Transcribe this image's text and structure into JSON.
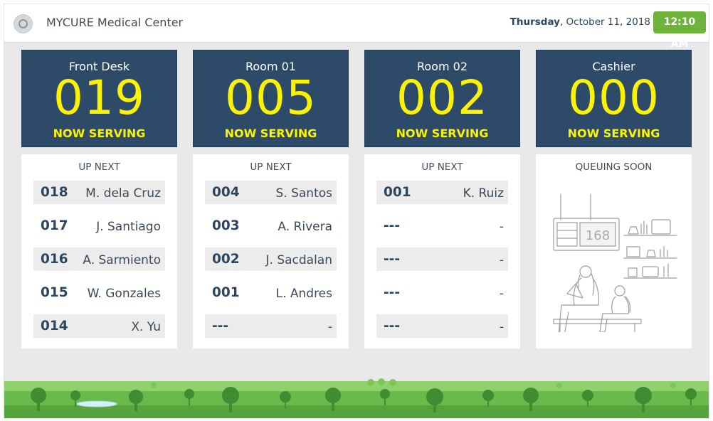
{
  "header": {
    "clinic_name": "MYCURE Medical Center",
    "day": "Thursday",
    "date": ", October 11, 2018",
    "time": "12:10 AM"
  },
  "counters": [
    {
      "name": "Front Desk",
      "number": "019",
      "status": "NOW SERVING",
      "queue_label": "UP NEXT",
      "queue": [
        {
          "q": "018",
          "name": "M. dela Cruz"
        },
        {
          "q": "017",
          "name": "J. Santiago"
        },
        {
          "q": "016",
          "name": "A. Sarmiento"
        },
        {
          "q": "015",
          "name": "W. Gonzales"
        },
        {
          "q": "014",
          "name": "X. Yu"
        }
      ]
    },
    {
      "name": "Room 01",
      "number": "005",
      "status": "NOW SERVING",
      "queue_label": "UP NEXT",
      "queue": [
        {
          "q": "004",
          "name": "S. Santos"
        },
        {
          "q": "003",
          "name": "A. Rivera"
        },
        {
          "q": "002",
          "name": "J. Sacdalan"
        },
        {
          "q": "001",
          "name": "L. Andres"
        },
        {
          "q": "---",
          "name": "-"
        }
      ]
    },
    {
      "name": "Room 02",
      "number": "002",
      "status": "NOW SERVING",
      "queue_label": "UP NEXT",
      "queue": [
        {
          "q": "001",
          "name": "K. Ruiz"
        },
        {
          "q": "---",
          "name": "-"
        },
        {
          "q": "---",
          "name": "-"
        },
        {
          "q": "---",
          "name": "-"
        },
        {
          "q": "---",
          "name": "-"
        }
      ]
    },
    {
      "name": "Cashier",
      "number": "000",
      "status": "NOW SERVING",
      "queue_label": "QUEUING SOON",
      "illustration_number": "168"
    }
  ],
  "colors": {
    "panel_navy": "#2e4a69",
    "highlight_yellow": "#fcf300",
    "clock_green": "#6fb33b"
  }
}
